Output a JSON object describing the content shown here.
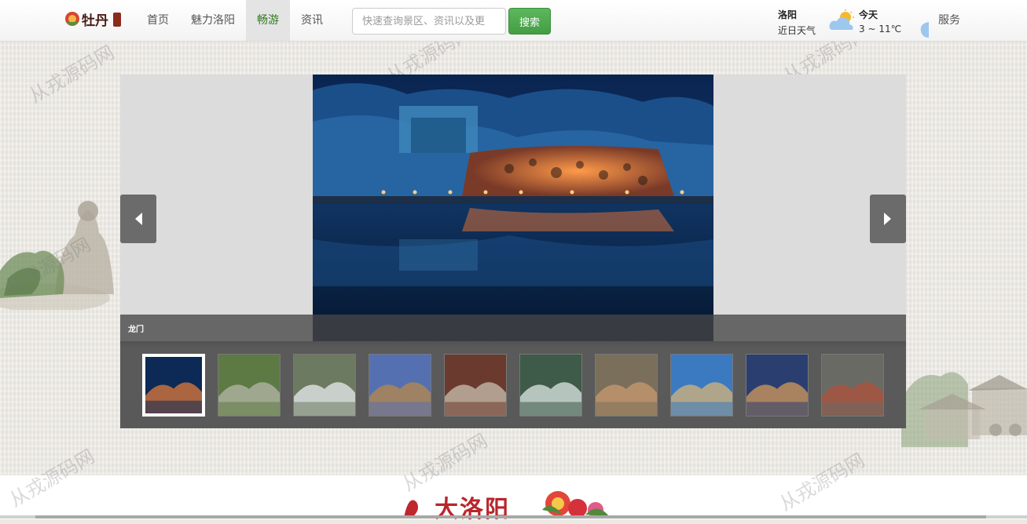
{
  "header": {
    "logo_text": "牡丹",
    "nav": [
      {
        "label": "首页"
      },
      {
        "label": "魅力洛阳"
      },
      {
        "label": "畅游",
        "active": true
      },
      {
        "label": "资讯"
      }
    ],
    "search": {
      "placeholder": "快速查询景区、资讯以及更",
      "button": "搜索"
    },
    "weather": {
      "city": "洛阳",
      "subtitle": "近日天气",
      "today_label": "今天",
      "temp": "3 ~ 11℃",
      "icon": "partly-cloudy-icon"
    },
    "service": "服务"
  },
  "slider": {
    "caption": "龙门",
    "active_index": 0,
    "thumbnails": [
      {
        "name": "thumb-longmen",
        "colors": [
          "#0c2a55",
          "#e07a3a"
        ]
      },
      {
        "name": "thumb-garden-path",
        "colors": [
          "#5d7a45",
          "#b7b7a8"
        ]
      },
      {
        "name": "thumb-waterfall",
        "colors": [
          "#6b7a60",
          "#e8eef0"
        ]
      },
      {
        "name": "thumb-temple-hill",
        "colors": [
          "#5570b0",
          "#b8884a"
        ]
      },
      {
        "name": "thumb-gate",
        "colors": [
          "#6b3a2e",
          "#c8c0b0"
        ]
      },
      {
        "name": "thumb-cascade",
        "colors": [
          "#3e5a48",
          "#dfe8e6"
        ]
      },
      {
        "name": "thumb-rock-cave",
        "colors": [
          "#7a6f5a",
          "#c89a70"
        ]
      },
      {
        "name": "thumb-mountain-pavilion",
        "colors": [
          "#3b7ac0",
          "#d6b47a"
        ]
      },
      {
        "name": "thumb-night-wall",
        "colors": [
          "#2a3f70",
          "#d49a5a"
        ]
      },
      {
        "name": "thumb-misty-forest",
        "colors": [
          "#6a6a64",
          "#b0523a"
        ]
      }
    ]
  },
  "footer": {
    "banner_text": "大洛阳"
  },
  "watermark": "从戎源码网",
  "colors": {
    "accent_green": "#449d44",
    "nav_active": "#2f7a1e",
    "banner_red": "#b8262b"
  }
}
